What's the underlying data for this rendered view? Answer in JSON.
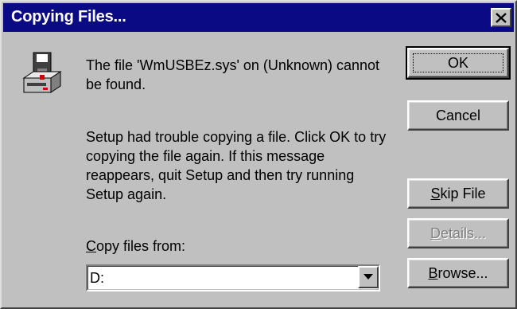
{
  "window": {
    "title": "Copying Files...",
    "close_glyph": "X"
  },
  "message": {
    "line1": "The file 'WmUSBEz.sys' on (Unknown) cannot be found.",
    "line2": "Setup had trouble copying a file. Click OK to try copying the file again. If this message reappears, quit Setup and then try running Setup again."
  },
  "copy_from": {
    "label_prefix": "",
    "label_mnemonic": "C",
    "label_rest": "opy files from:",
    "value": "D:"
  },
  "buttons": {
    "ok": "OK",
    "cancel": "Cancel",
    "skip_mnemonic": "S",
    "skip_rest": "kip File",
    "details_mnemonic": "D",
    "details_rest": "etails...",
    "browse_mnemonic": "B",
    "browse_rest": "rowse..."
  },
  "colors": {
    "titlebar": "#0a0a84",
    "face": "#c0c0c0",
    "disabled_text": "#808080"
  },
  "icons": {
    "dialog_icon": "floppy-drive-icon",
    "dropdown": "chevron-down-icon",
    "close": "close-icon"
  }
}
